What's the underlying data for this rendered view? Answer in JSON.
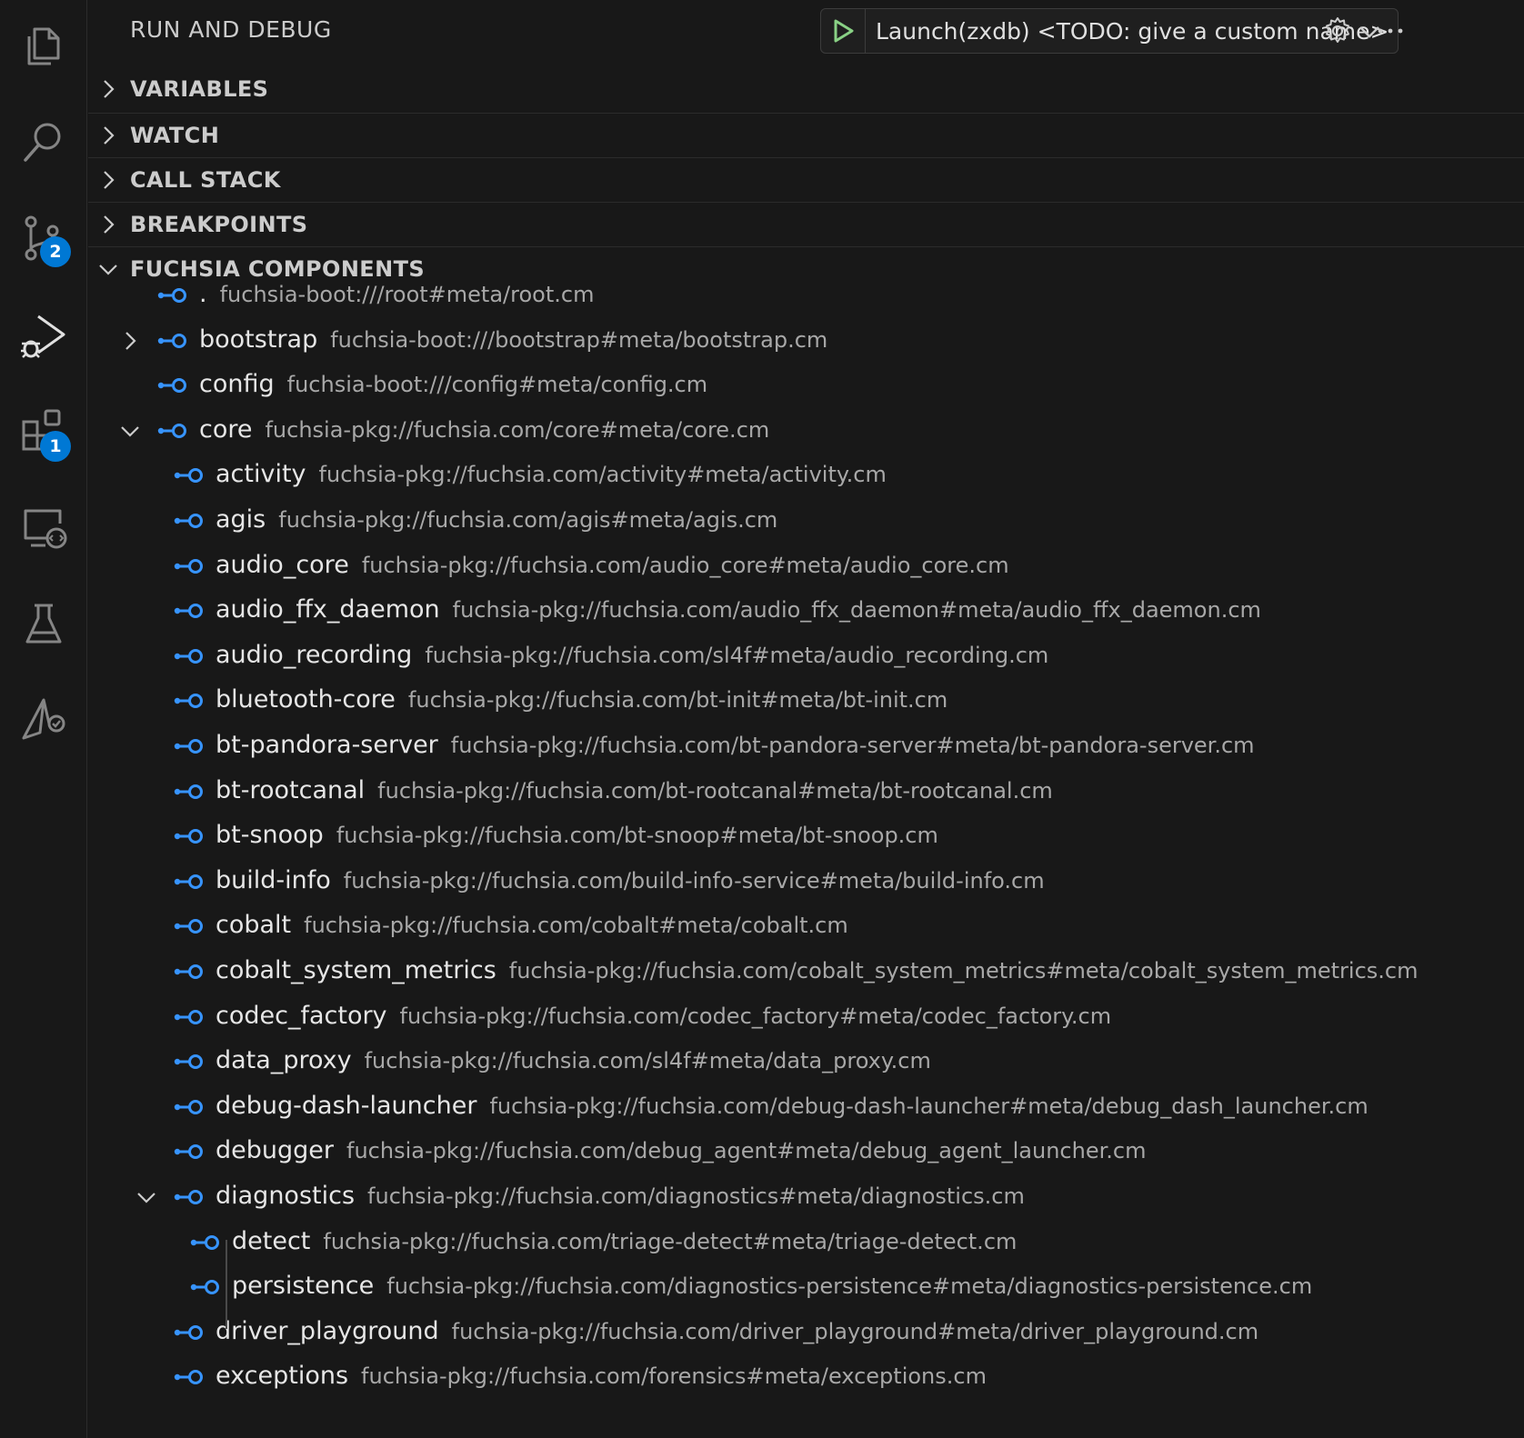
{
  "activity_bar": {
    "items": [
      {
        "name": "explorer",
        "icon": "files-icon"
      },
      {
        "name": "search",
        "icon": "search-icon"
      },
      {
        "name": "source-control",
        "icon": "source-control-icon",
        "badge": "2"
      },
      {
        "name": "run-and-debug",
        "icon": "run-debug-icon"
      },
      {
        "name": "extensions",
        "icon": "extensions-icon",
        "badge": "1"
      },
      {
        "name": "remote-explorer",
        "icon": "remote-explorer-icon"
      },
      {
        "name": "testing",
        "icon": "beaker-icon"
      },
      {
        "name": "fuchsia",
        "icon": "fuchsia-icon"
      }
    ],
    "badge_color": "#0078d4"
  },
  "header": {
    "title": "RUN AND DEBUG",
    "launch_config": "Launch(zxdb) <TODO: give a custom name>",
    "play_color": "#89d185"
  },
  "sections": {
    "variables": "VARIABLES",
    "watch": "WATCH",
    "call_stack": "CALL STACK",
    "breakpoints": "BREAKPOINTS",
    "fuchsia_components": "FUCHSIA COMPONENTS"
  },
  "icon_color": "#3794ff",
  "components": [
    {
      "name": ".",
      "url": "fuchsia-boot:///root#meta/root.cm"
    },
    {
      "name": "bootstrap",
      "url": "fuchsia-boot:///bootstrap#meta/bootstrap.cm",
      "expander": "collapsed"
    },
    {
      "name": "config",
      "url": "fuchsia-boot:///config#meta/config.cm"
    },
    {
      "name": "core",
      "url": "fuchsia-pkg://fuchsia.com/core#meta/core.cm",
      "expander": "expanded"
    },
    {
      "name": "activity",
      "url": "fuchsia-pkg://fuchsia.com/activity#meta/activity.cm"
    },
    {
      "name": "agis",
      "url": "fuchsia-pkg://fuchsia.com/agis#meta/agis.cm"
    },
    {
      "name": "audio_core",
      "url": "fuchsia-pkg://fuchsia.com/audio_core#meta/audio_core.cm"
    },
    {
      "name": "audio_ffx_daemon",
      "url": "fuchsia-pkg://fuchsia.com/audio_ffx_daemon#meta/audio_ffx_daemon.cm"
    },
    {
      "name": "audio_recording",
      "url": "fuchsia-pkg://fuchsia.com/sl4f#meta/audio_recording.cm"
    },
    {
      "name": "bluetooth-core",
      "url": "fuchsia-pkg://fuchsia.com/bt-init#meta/bt-init.cm"
    },
    {
      "name": "bt-pandora-server",
      "url": "fuchsia-pkg://fuchsia.com/bt-pandora-server#meta/bt-pandora-server.cm"
    },
    {
      "name": "bt-rootcanal",
      "url": "fuchsia-pkg://fuchsia.com/bt-rootcanal#meta/bt-rootcanal.cm"
    },
    {
      "name": "bt-snoop",
      "url": "fuchsia-pkg://fuchsia.com/bt-snoop#meta/bt-snoop.cm"
    },
    {
      "name": "build-info",
      "url": "fuchsia-pkg://fuchsia.com/build-info-service#meta/build-info.cm"
    },
    {
      "name": "cobalt",
      "url": "fuchsia-pkg://fuchsia.com/cobalt#meta/cobalt.cm"
    },
    {
      "name": "cobalt_system_metrics",
      "url": "fuchsia-pkg://fuchsia.com/cobalt_system_metrics#meta/cobalt_system_metrics.cm"
    },
    {
      "name": "codec_factory",
      "url": "fuchsia-pkg://fuchsia.com/codec_factory#meta/codec_factory.cm"
    },
    {
      "name": "data_proxy",
      "url": "fuchsia-pkg://fuchsia.com/sl4f#meta/data_proxy.cm"
    },
    {
      "name": "debug-dash-launcher",
      "url": "fuchsia-pkg://fuchsia.com/debug-dash-launcher#meta/debug_dash_launcher.cm"
    },
    {
      "name": "debugger",
      "url": "fuchsia-pkg://fuchsia.com/debug_agent#meta/debug_agent_launcher.cm"
    },
    {
      "name": "diagnostics",
      "url": "fuchsia-pkg://fuchsia.com/diagnostics#meta/diagnostics.cm",
      "expander": "expanded"
    },
    {
      "name": "detect",
      "url": "fuchsia-pkg://fuchsia.com/triage-detect#meta/triage-detect.cm"
    },
    {
      "name": "persistence",
      "url": "fuchsia-pkg://fuchsia.com/diagnostics-persistence#meta/diagnostics-persistence.cm"
    },
    {
      "name": "driver_playground",
      "url": "fuchsia-pkg://fuchsia.com/driver_playground#meta/driver_playground.cm"
    },
    {
      "name": "exceptions",
      "url": "fuchsia-pkg://fuchsia.com/forensics#meta/exceptions.cm"
    }
  ]
}
